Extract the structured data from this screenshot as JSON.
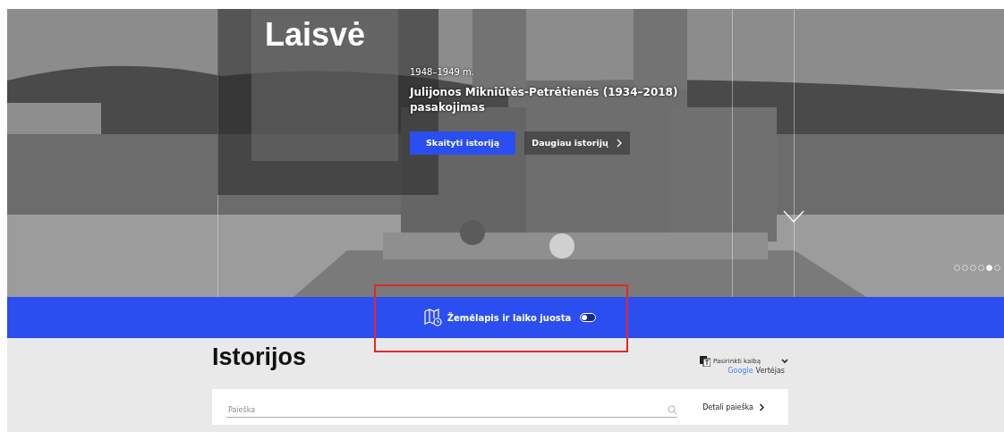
{
  "hero": {
    "title": "Laisvė",
    "period": "1948–1949 m.",
    "story_title": "Julijonos Mikniūtės-Petrėtienės (1934–2018) pasakojimas",
    "primary_button": "Skaityti istoriją",
    "secondary_button": "Daugiau istorijų",
    "slides": [
      {
        "selected": false
      },
      {
        "selected": false
      },
      {
        "selected": false
      },
      {
        "selected": false
      },
      {
        "selected": true
      },
      {
        "selected": false
      }
    ]
  },
  "map_bar": {
    "label": "Žemėlapis ir laiko juosta",
    "on": false
  },
  "stories": {
    "heading": "Istorijos",
    "language": {
      "label": "Pasirinkti kalbą",
      "brand": "Google",
      "service": "Vertėjas"
    },
    "search": {
      "placeholder": "Paieška"
    },
    "detailed_search": "Detali paieška"
  }
}
